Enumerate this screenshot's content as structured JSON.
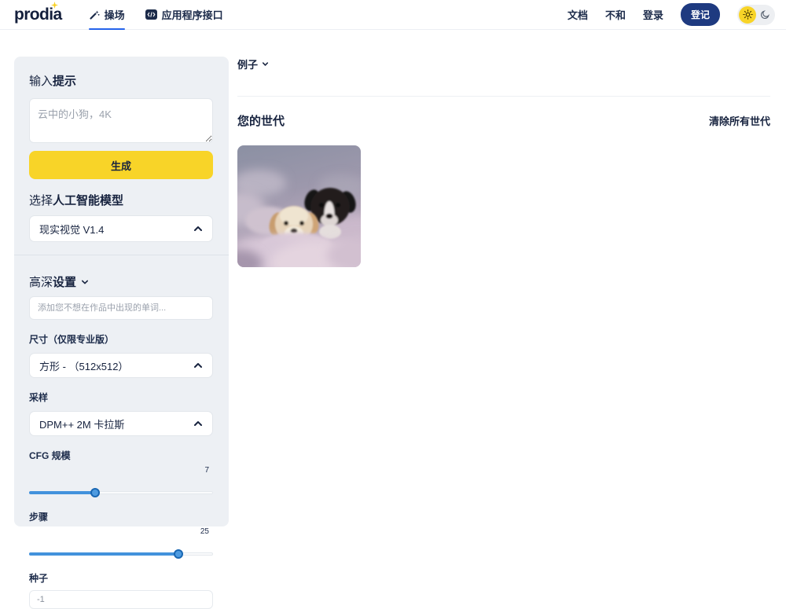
{
  "brand": {
    "logo_text": "prodia"
  },
  "navbar": {
    "tabs": [
      {
        "label": "操场",
        "icon": "wand-icon",
        "active": true
      },
      {
        "label": "应用程序接口",
        "icon": "code-icon",
        "active": false
      }
    ],
    "links": [
      "文档",
      "不和",
      "登录"
    ],
    "register_label": "登记"
  },
  "sidebar": {
    "prompt_heading_normal": "输入",
    "prompt_heading_bold": "提示",
    "prompt_placeholder": "云中的小狗，4K",
    "generate_label": "生成",
    "model_heading_normal": "选择",
    "model_heading_bold": "人工智能模型",
    "model_value": "现实视觉 V1.4",
    "advanced_heading_normal": "高深",
    "advanced_heading_bold": "设置",
    "negative_placeholder": "添加您不想在作品中出现的单词...",
    "size_label": "尺寸（仅限专业版）",
    "size_value": "方形 - （512x512）",
    "sampler_label": "采样",
    "sampler_value": "DPM++ 2M 卡拉斯",
    "cfg_label": "CFG 规模",
    "cfg_value": "7",
    "steps_label": "步骤",
    "steps_value": "25",
    "seed_label": "种子",
    "seed_value": "-1",
    "sliders": {
      "cfg_percent": 36,
      "steps_percent": 81
    }
  },
  "main": {
    "examples_label": "例子",
    "generations_heading": "您的世代",
    "clear_all_label": "清除所有世代"
  },
  "colors": {
    "accent-yellow": "#F8D428",
    "navy": "#1E3A80",
    "link-blue": "#2563EB",
    "slider-blue": "#4292DC",
    "sidebar-bg": "#EDF0F4"
  }
}
